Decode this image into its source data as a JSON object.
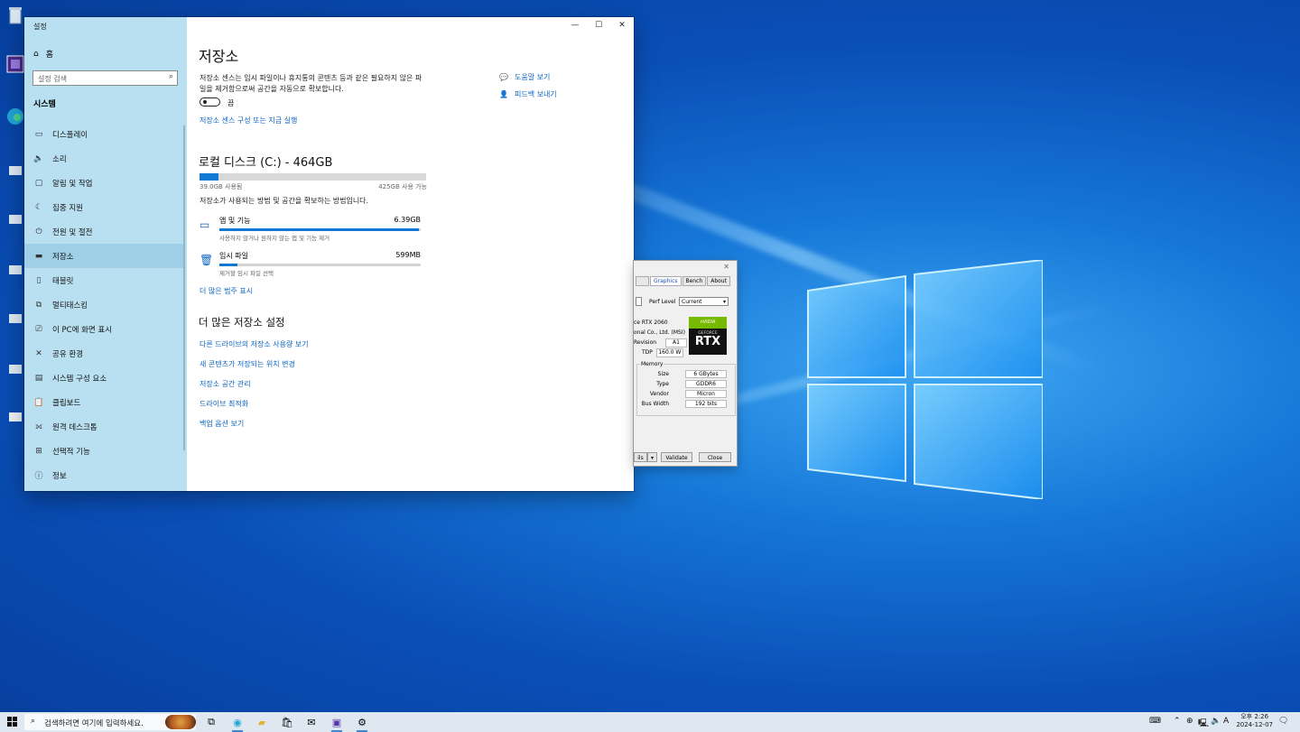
{
  "settings": {
    "title": "설정",
    "home": "홈",
    "search_placeholder": "설정 검색",
    "section": "시스템",
    "nav": [
      {
        "icon": "display-icon",
        "label": "디스플레이"
      },
      {
        "icon": "sound-icon",
        "label": "소리"
      },
      {
        "icon": "notifications-icon",
        "label": "알림 및 작업"
      },
      {
        "icon": "focus-assist-icon",
        "label": "집중 지원"
      },
      {
        "icon": "power-icon",
        "label": "전원 및 절전"
      },
      {
        "icon": "storage-icon",
        "label": "저장소"
      },
      {
        "icon": "tablet-icon",
        "label": "태블릿"
      },
      {
        "icon": "multitasking-icon",
        "label": "멀티태스킹"
      },
      {
        "icon": "projecting-icon",
        "label": "이 PC에 화면 표시"
      },
      {
        "icon": "shared-experiences-icon",
        "label": "공유 환경"
      },
      {
        "icon": "system-components-icon",
        "label": "시스템 구성 요소"
      },
      {
        "icon": "clipboard-icon",
        "label": "클립보드"
      },
      {
        "icon": "remote-desktop-icon",
        "label": "원격 데스크톱"
      },
      {
        "icon": "optional-features-icon",
        "label": "선택적 기능"
      },
      {
        "icon": "info-icon",
        "label": "정보"
      }
    ],
    "active_index": 5,
    "page": {
      "title": "저장소",
      "sense_desc": "저장소 센스는 임시 파일이나 휴지통의 콘텐츠 등과 같은 필요하지 않은 파일을 제거함으로써 공간을 자동으로 확보합니다.",
      "toggle_label": "끔",
      "toggle_on": false,
      "sense_link": "저장소 센스 구성 또는 지금 실행",
      "help": [
        "도움말 보기",
        "피드백 보내기"
      ],
      "disk_title": "로컬 디스크 (C:) - 464GB",
      "disk_used_fraction": 0.084,
      "used_text": "39.0GB 사용됨",
      "free_text": "425GB 사용 가능",
      "how_text": "저장소가 사용되는 방법 및 공간을 확보하는 방법입니다.",
      "categories": [
        {
          "icon": "apps-icon",
          "name": "앱 및 기능",
          "size": "6.39GB",
          "fraction": 0.99,
          "sub": "사용하지 않거나 원하지 않는 앱 및 기능 제거"
        },
        {
          "icon": "trash-icon",
          "name": "임시 파일",
          "size": "599MB",
          "fraction": 0.09,
          "sub": "제거할 임시 파일 선택"
        }
      ],
      "more_categories": "더 많은 범주 표시",
      "more_title": "더 많은 저장소 설정",
      "more_links": [
        "다른 드라이브의 저장소 사용량 보기",
        "새 콘텐츠가 저장되는 위치 변경",
        "저장소 공간 관리",
        "드라이브 최적화",
        "백업 옵션 보기"
      ]
    }
  },
  "gpuz": {
    "tabs": [
      "Graphics",
      "Bench",
      "About"
    ],
    "perf_label": "Perf Level",
    "perf_value": "Current",
    "rows": [
      "ce RTX 2060",
      "onal Co., Ltd. (MSI)",
      "Revision",
      "TDP"
    ],
    "revision": "A1",
    "tdp": "160.0 W",
    "logo_top": "nVIDIA",
    "logo_mid": "GEFORCE",
    "logo_main": "RTX",
    "memory_label": "Memory",
    "memory": [
      {
        "k": "Size",
        "v": "6 GBytes"
      },
      {
        "k": "Type",
        "v": "GDDR6"
      },
      {
        "k": "Vendor",
        "v": "Micron"
      },
      {
        "k": "Bus Width",
        "v": "192 bits"
      }
    ],
    "btn_left": "ils",
    "btn_validate": "Validate",
    "btn_close": "Close"
  },
  "taskbar": {
    "search_text": "검색하려면 여기에 입력하세요.",
    "ime": "A",
    "time": "오후 2:26",
    "date": "2024-12-07"
  }
}
